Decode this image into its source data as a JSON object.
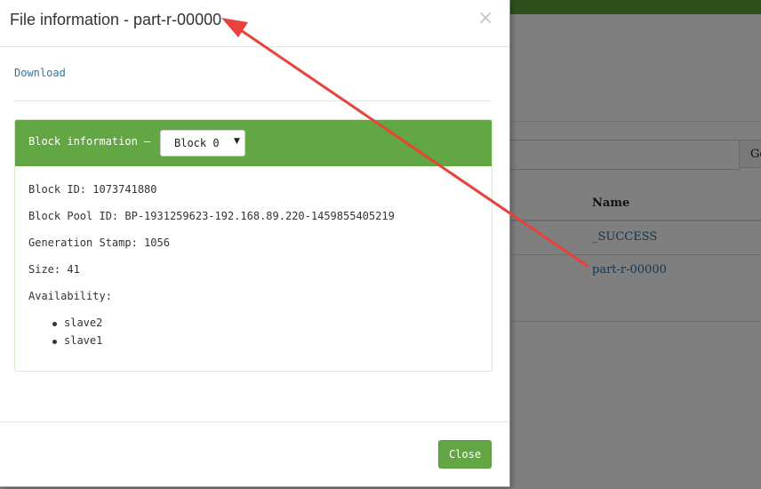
{
  "modal": {
    "title": "File information - part-r-00000",
    "close_icon": "×",
    "download_label": "Download",
    "block_header_label": "Block information —",
    "block_select_value": "Block 0",
    "block_select_caret": "▼",
    "block_id": "Block ID: 1073741880",
    "block_pool_id": "Block Pool ID: BP-1931259623-192.168.89.220-1459855405219",
    "generation_stamp": "Generation Stamp: 1056",
    "size": "Size: 41",
    "availability_label": "Availability:",
    "availability": [
      "slave2",
      "slave1"
    ],
    "close_button": "Close"
  },
  "background": {
    "go_button": "Go",
    "name_header": "Name",
    "files": [
      "_SUCCESS",
      "part-r-00000"
    ]
  },
  "colors": {
    "accent_green": "#62a744",
    "link_blue": "#2a7aa8",
    "annotation_red": "#e8423a"
  },
  "annotation": {
    "type": "arrow",
    "from": "part-r-00000 row",
    "to": "modal title"
  }
}
